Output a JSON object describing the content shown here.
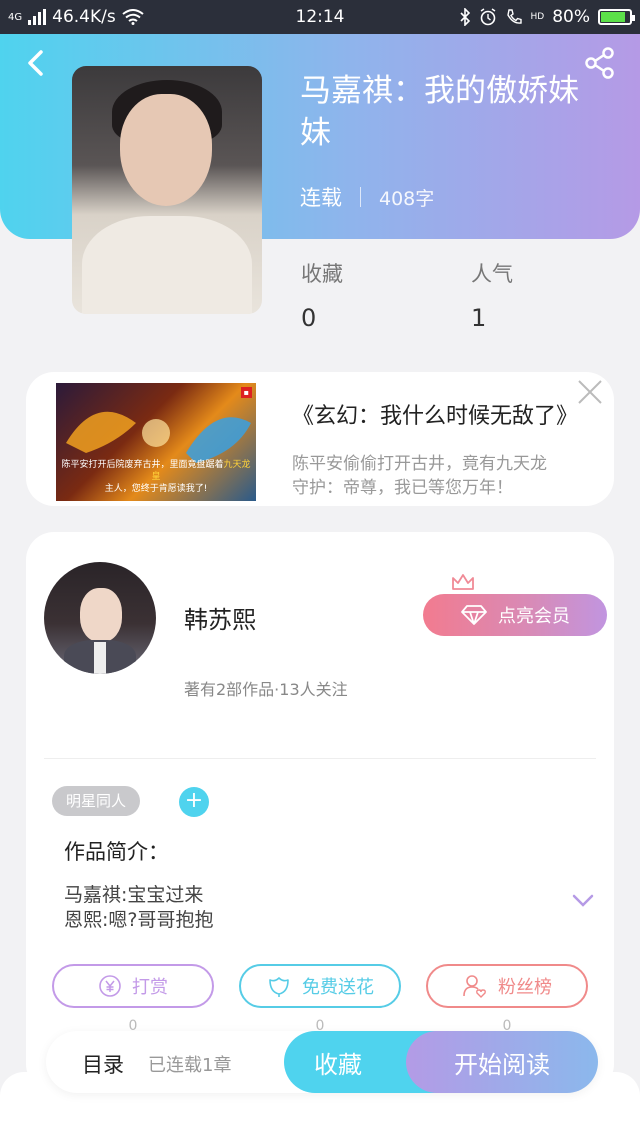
{
  "status_bar": {
    "network": "4G",
    "speed": "46.4K/s",
    "time": "12:14",
    "hd": "HD",
    "battery": "80%",
    "battery_level": 0.8
  },
  "book": {
    "title": "马嘉祺：我的傲娇妹妹",
    "status": "连载",
    "word_count": "408字"
  },
  "stats": {
    "favorites_label": "收藏",
    "favorites_value": "0",
    "popularity_label": "人气",
    "popularity_value": "1"
  },
  "ad": {
    "title": "《玄幻：我什么时候无敌了》",
    "desc_line1": "陈平安偷偷打开古井，竟有九天龙",
    "desc_line2": "守护：帝尊，我已等您万年！",
    "img_caption_a": "陈平安打开后院废弃古井，里面竟盘踞着",
    "img_caption_hl": "九天龙皇",
    "img_caption_b": "主人，您终于肯愿读我了!"
  },
  "author": {
    "name": "韩苏熙",
    "info": "著有2部作品·13人关注",
    "vip_label": "点亮会员"
  },
  "tag": "明星同人",
  "plus": "+",
  "intro": {
    "heading": "作品简介：",
    "line1": "马嘉祺:宝宝过来",
    "line2": "恩熙:嗯?哥哥抱抱"
  },
  "actions": {
    "tip_label": "打赏",
    "tip_count": "0",
    "flower_label": "免费送花",
    "flower_count": "0",
    "fans_label": "粉丝榜",
    "fans_count": "0"
  },
  "bottom": {
    "toc_label": "目录",
    "toc_sub": "已连载1章",
    "fav_label": "收藏",
    "read_label": "开始阅读"
  },
  "colors": {
    "accent": "#4fd3ee",
    "purple": "#b59ae6",
    "tip_border": "#c39ae8",
    "flower_border": "#56cce6",
    "fans_border": "#f08a8a"
  }
}
